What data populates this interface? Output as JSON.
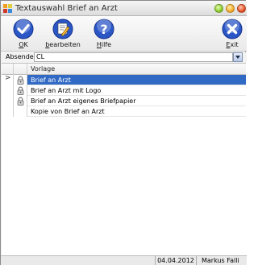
{
  "window": {
    "title": "Textauswahl Brief an Arzt"
  },
  "toolbar": {
    "buttons": [
      {
        "name": "ok",
        "label_u": "O",
        "label_rest": "K",
        "icon": "checkmark-icon"
      },
      {
        "name": "bearbeiten",
        "label_u": "b",
        "label_rest": "earbeiten",
        "icon": "edit-document-icon"
      },
      {
        "name": "hilfe",
        "label_u": "H",
        "label_rest": "ilfe",
        "icon": "help-icon"
      },
      {
        "name": "exit",
        "label_u": "E",
        "label_rest": "xit",
        "icon": "close-icon"
      }
    ]
  },
  "absender": {
    "label": "Absender",
    "value": "CL"
  },
  "grid": {
    "columns": [
      "",
      "",
      "Vorlage"
    ],
    "rows": [
      {
        "name": "Brief an Arzt",
        "locked": true,
        "selected": true,
        "indicator": ">"
      },
      {
        "name": "Brief an Arzt mit Logo",
        "locked": true,
        "selected": false,
        "indicator": ""
      },
      {
        "name": "Brief an Arzt eigenes Briefpapier",
        "locked": true,
        "selected": false,
        "indicator": ""
      },
      {
        "name": "Kopie von Brief an Arzt",
        "locked": false,
        "selected": false,
        "indicator": ""
      }
    ]
  },
  "status": {
    "date": "04.04.2012",
    "user": "Markus Falli"
  },
  "colors": {
    "selection": "#316ac5",
    "icon_blue": "#2a56c6"
  }
}
